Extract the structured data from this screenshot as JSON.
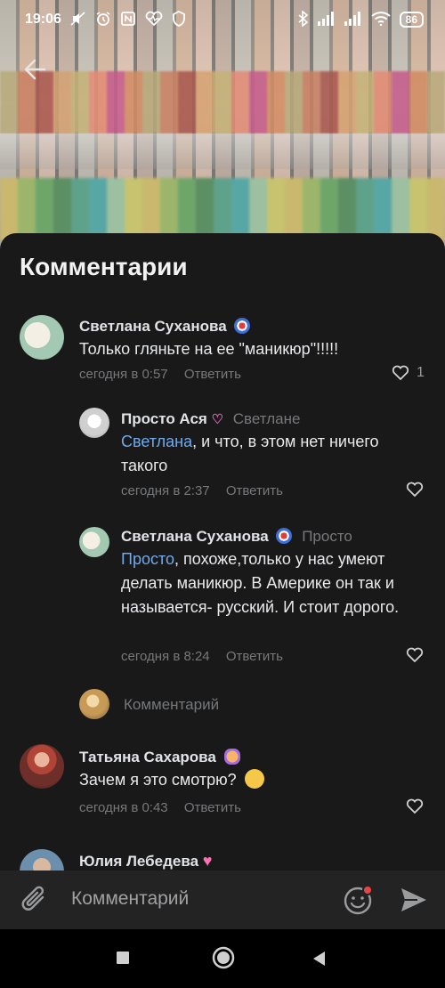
{
  "status_bar": {
    "time": "19:06",
    "battery": "86"
  },
  "sheet": {
    "title": "Комментарии"
  },
  "comments": [
    {
      "author": "Светлана Суханова",
      "text": "Только гляньте на ее \"маникюр\"!!!!!",
      "time": "сегодня в 0:57",
      "reply_label": "Ответить",
      "likes": "1"
    },
    {
      "author": "Просто Ася",
      "reply_to": "Светлане",
      "mention": "Светлана",
      "text": ", и что, в этом нет ничего такого",
      "time": "сегодня в 2:37",
      "reply_label": "Ответить"
    },
    {
      "author": "Светлана Суханова",
      "reply_to": "Просто",
      "mention": "Просто",
      "text": ", похоже,только у нас умеют делать маникюр. В Америке он так и называется- русский. И стоит дорого.",
      "time": "сегодня в 8:24",
      "reply_label": "Ответить"
    },
    {
      "author": "Татьяна Сахарова",
      "text": "Зачем я это смотрю?",
      "time": "сегодня в 0:43",
      "reply_label": "Ответить"
    },
    {
      "author": "Юлия Лебедева"
    }
  ],
  "thread_reply": {
    "placeholder": "Комментарий"
  },
  "composer": {
    "placeholder": "Комментарий"
  },
  "colors": {
    "sheet_bg": "#19191a",
    "composer_bg": "#232324",
    "mention": "#71aaeb",
    "secondary_text": "#76787a",
    "unread_dot": "#e64646"
  }
}
